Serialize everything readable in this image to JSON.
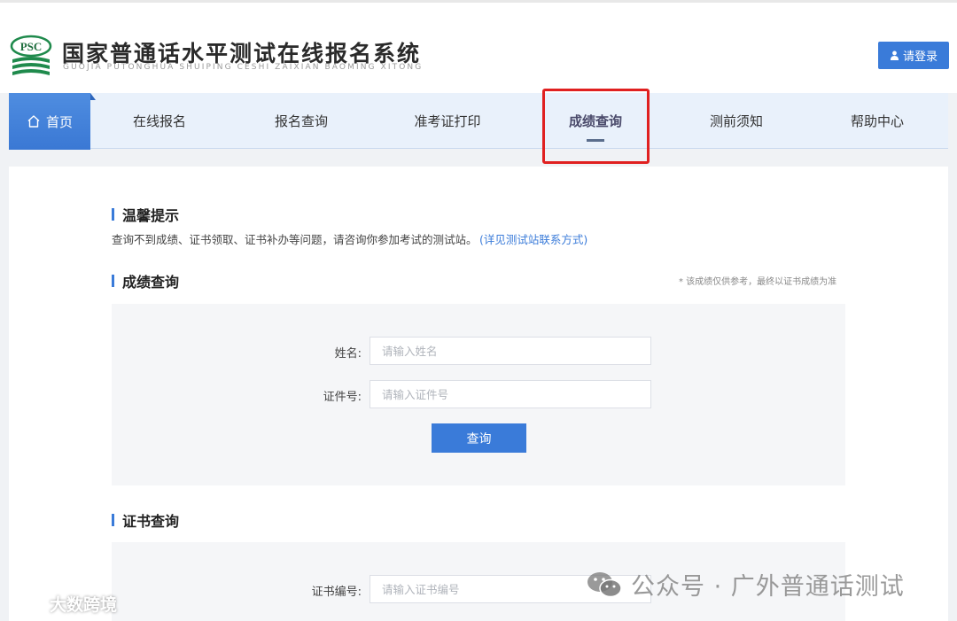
{
  "header": {
    "logo_text": "PSC",
    "title": "国家普通话水平测试在线报名系统",
    "pinyin": "GUOJIA PUTONGHUA SHUIPING CESHI ZAIXIAN BAOMING XITONG",
    "login_label": "请登录"
  },
  "nav": {
    "home": "首页",
    "items": [
      {
        "label": "在线报名"
      },
      {
        "label": "报名查询"
      },
      {
        "label": "准考证打印"
      },
      {
        "label": "成绩查询"
      },
      {
        "label": "测前须知"
      },
      {
        "label": "帮助中心"
      }
    ]
  },
  "tips": {
    "title": "温馨提示",
    "text": "查询不到成绩、证书领取、证书补办等问题，请咨询你参加考试的测试站。",
    "link": "(详见测试站联系方式)"
  },
  "score_query": {
    "title": "成绩查询",
    "note": "* 该成绩仅供参考，最终以证书成绩为准",
    "name_label": "姓名:",
    "name_placeholder": "请输入姓名",
    "id_label": "证件号:",
    "id_placeholder": "请输入证件号",
    "submit_label": "查询"
  },
  "cert_query": {
    "title": "证书查询",
    "cert_label": "证书编号:",
    "cert_placeholder": "请输入证书编号"
  },
  "watermarks": {
    "left": "大数跨境",
    "right": "公众号 · 广外普通话测试"
  },
  "colors": {
    "accent": "#3a7bd9",
    "nav_bg": "#e9f1fb",
    "highlight": "#e02020"
  }
}
